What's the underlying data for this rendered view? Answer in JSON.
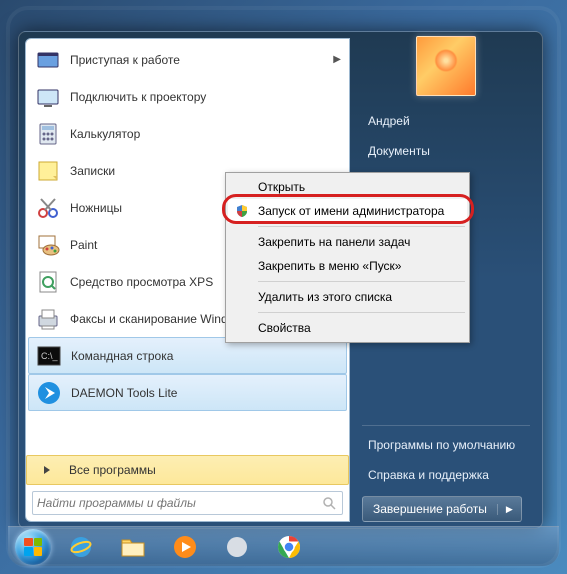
{
  "programs": [
    {
      "label": "Приступая к работе",
      "has_submenu": true,
      "icon": "getting-started"
    },
    {
      "label": "Подключить к проектору",
      "icon": "projector"
    },
    {
      "label": "Калькулятор",
      "icon": "calculator"
    },
    {
      "label": "Записки",
      "icon": "sticky-notes"
    },
    {
      "label": "Ножницы",
      "icon": "snipping-tool"
    },
    {
      "label": "Paint",
      "icon": "paint"
    },
    {
      "label": "Средство просмотра XPS",
      "icon": "xps-viewer"
    },
    {
      "label": "Факсы и сканирование Windows",
      "icon": "fax-scan"
    },
    {
      "label": "Командная строка",
      "icon": "cmd",
      "highlighted": true
    },
    {
      "label": "DAEMON Tools Lite",
      "icon": "daemon-tools",
      "highlighted": true
    }
  ],
  "all_programs_label": "Все программы",
  "search": {
    "placeholder": "Найти программы и файлы"
  },
  "right_pane": {
    "user_name": "Андрей",
    "items_top": [
      "Документы"
    ],
    "items_bottom": [
      "Программы по умолчанию",
      "Справка и поддержка"
    ]
  },
  "shutdown": {
    "label": "Завершение работы"
  },
  "context_menu": {
    "items": [
      {
        "label": "Открыть"
      },
      {
        "label": "Запуск от имени администратора",
        "icon": "shield",
        "highlighted": true
      },
      {
        "sep": true
      },
      {
        "label": "Закрепить на панели задач"
      },
      {
        "label": "Закрепить в меню «Пуск»"
      },
      {
        "sep": true
      },
      {
        "label": "Удалить из этого списка"
      },
      {
        "sep": true
      },
      {
        "label": "Свойства"
      }
    ]
  },
  "taskbar": {
    "items": [
      "ie",
      "explorer",
      "media-player",
      "app-gray",
      "chrome"
    ]
  }
}
